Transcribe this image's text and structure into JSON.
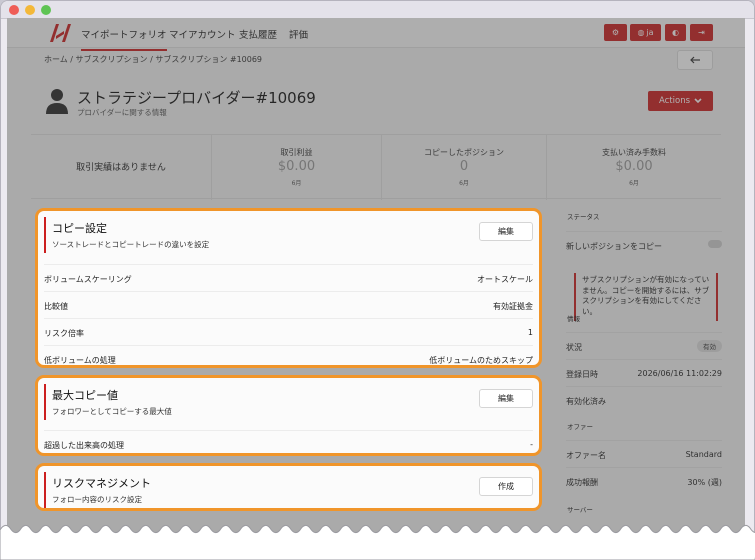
{
  "nav": {
    "items": [
      "マイポートフォリオ",
      "マイアカウント",
      "支払履歴",
      "評価"
    ],
    "lang_label": "ja"
  },
  "breadcrumb": "ホーム / サブスクリプション / サブスクリプション #10069",
  "page": {
    "title": "ストラテジープロバイダー#10069",
    "subtitle": "プロバイダーに関する情報",
    "actions_label": "Actions"
  },
  "stats": {
    "no_results": "取引実績はありません",
    "items": [
      {
        "label": "取引利益",
        "value": "$0.00",
        "unit": "6月"
      },
      {
        "label": "コピーしたポジション",
        "value": "0",
        "unit": "6月"
      },
      {
        "label": "支払い済み手数料",
        "value": "$0.00",
        "unit": "6月"
      }
    ]
  },
  "cards": {
    "copy_settings": {
      "title": "コピー設定",
      "desc": "ソーストレードとコピートレードの違いを設定",
      "button": "編集",
      "rows": [
        {
          "label": "ボリュームスケーリング",
          "value": "オートスケール"
        },
        {
          "label": "比較値",
          "value": "有効証拠金"
        },
        {
          "label": "リスク倍率",
          "value": "1"
        },
        {
          "label": "低ボリュームの処理",
          "value": "低ボリュームのためスキップ"
        }
      ]
    },
    "max_copy": {
      "title": "最大コピー値",
      "desc": "フォロワーとしてコピーする最大値",
      "button": "編集",
      "rows": [
        {
          "label": "超過した出来高の処理",
          "value": "-"
        }
      ]
    },
    "risk": {
      "title": "リスクマネジメント",
      "desc": "フォロー内容のリスク設定",
      "button": "作成"
    }
  },
  "right_panel": {
    "status_head": "ステータス",
    "copy_new_label": "新しいポジションをコピー",
    "alert_text": "サブスクリプションが有効になっていません。コピーを開始するには、サブスクリプションを有効にしてください。",
    "info_head": "情報",
    "status_label": "状況",
    "status_value": "有効",
    "registered_label": "登録日時",
    "registered_value": "2026/06/16 11:02:29",
    "activated_label": "有効化済み",
    "offer_head": "オファー",
    "offer_name_label": "オファー名",
    "offer_name_value": "Standard",
    "fee_label": "成功報酬",
    "fee_value": "30% (週)",
    "server_head": "サーバー"
  },
  "colors": {
    "brand_red": "#cc1f1f",
    "highlight_orange": "#f0952a"
  }
}
